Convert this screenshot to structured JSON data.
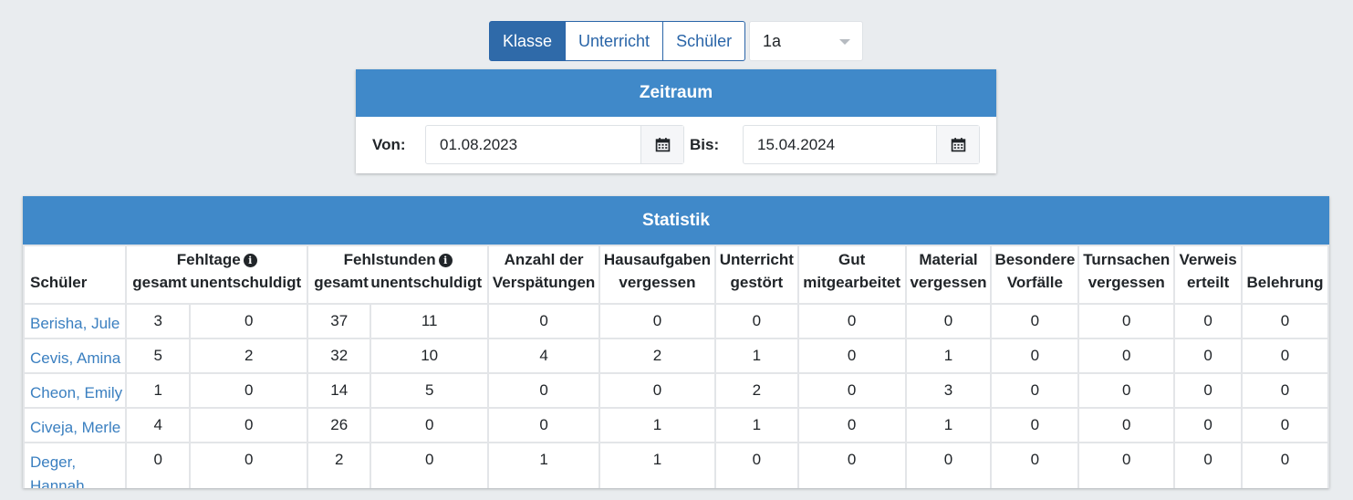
{
  "toolbar": {
    "tabs": [
      {
        "label": "Klasse",
        "active": true
      },
      {
        "label": "Unterricht",
        "active": false
      },
      {
        "label": "Schüler",
        "active": false
      }
    ],
    "class_select": {
      "value": "1a"
    }
  },
  "zeitraum": {
    "title": "Zeitraum",
    "from_label": "Von:",
    "from_value": "01.08.2023",
    "to_label": "Bis:",
    "to_value": "15.04.2024"
  },
  "statistik": {
    "title": "Statistik",
    "headers": {
      "student": "Schüler",
      "fehltage": "Fehltage",
      "fehlstunden": "Fehlstunden",
      "gesamt": "gesamt",
      "unentschuldigt": "unentschuldigt",
      "verspaetungen_1": "Anzahl der",
      "verspaetungen_2": "Verspätungen",
      "hausaufgaben_1": "Hausaufgaben",
      "hausaufgaben_2": "vergessen",
      "unterricht_1": "Unterricht",
      "unterricht_2": "gestört",
      "gut_1": "Gut",
      "gut_2": "mitgearbeitet",
      "material_1": "Material",
      "material_2": "vergessen",
      "vorfaelle_1": "Besondere",
      "vorfaelle_2": "Vorfälle",
      "turnsachen_1": "Turnsachen",
      "turnsachen_2": "vergessen",
      "verweis_1": "Verweis",
      "verweis_2": "erteilt",
      "belehrung": "Belehrung"
    },
    "rows": [
      {
        "name": "Berisha, Jule",
        "values": [
          "3",
          "0",
          "37",
          "11",
          "0",
          "0",
          "0",
          "0",
          "0",
          "0",
          "0",
          "0",
          "0"
        ]
      },
      {
        "name": "Cevis, Amina",
        "values": [
          "5",
          "2",
          "32",
          "10",
          "4",
          "2",
          "1",
          "0",
          "1",
          "0",
          "0",
          "0",
          "0"
        ]
      },
      {
        "name": "Cheon, Emily",
        "values": [
          "1",
          "0",
          "14",
          "5",
          "0",
          "0",
          "2",
          "0",
          "3",
          "0",
          "0",
          "0",
          "0"
        ]
      },
      {
        "name": "Civeja, Merle",
        "values": [
          "4",
          "0",
          "26",
          "0",
          "0",
          "1",
          "1",
          "0",
          "1",
          "0",
          "0",
          "0",
          "0"
        ]
      },
      {
        "name": "Deger, Hannah",
        "values": [
          "0",
          "0",
          "2",
          "0",
          "1",
          "1",
          "0",
          "0",
          "0",
          "0",
          "0",
          "0",
          "0"
        ]
      }
    ]
  },
  "colors": {
    "primary": "#4089c9",
    "active_button": "#2f6aa9",
    "link": "#3a7fc0",
    "background": "#e9ecef"
  }
}
